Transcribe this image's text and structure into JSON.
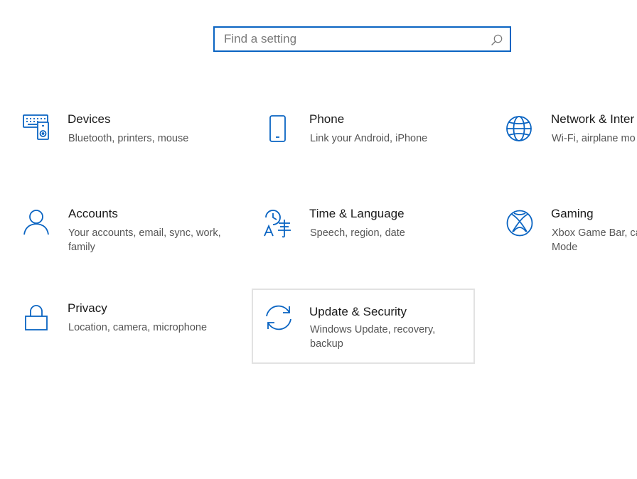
{
  "search": {
    "placeholder": "Find a setting"
  },
  "colors": {
    "accent": "#0a64c2",
    "title_text": "#1a1a1a",
    "desc_text": "#555555",
    "selected_border": "#e2e2e2"
  },
  "tiles": [
    {
      "title": "Devices",
      "description": "Bluetooth, printers, mouse",
      "icon": "devices-icon"
    },
    {
      "title": "Phone",
      "description": "Link your Android, iPhone",
      "icon": "phone-icon"
    },
    {
      "title": "Network & Inter",
      "description": "Wi-Fi, airplane mo",
      "icon": "globe-icon"
    },
    {
      "title": "Accounts",
      "description": "Your accounts, email, sync, work, family",
      "icon": "person-icon"
    },
    {
      "title": "Time & Language",
      "description": "Speech, region, date",
      "icon": "time-language-icon"
    },
    {
      "title": "Gaming",
      "description": "Xbox Game Bar, ca Mode",
      "icon": "xbox-icon"
    },
    {
      "title": "Privacy",
      "description": "Location, camera, microphone",
      "icon": "lock-icon"
    },
    {
      "title": "Update & Security",
      "description": "Windows Update, recovery, backup",
      "icon": "sync-icon",
      "selected": true
    }
  ]
}
